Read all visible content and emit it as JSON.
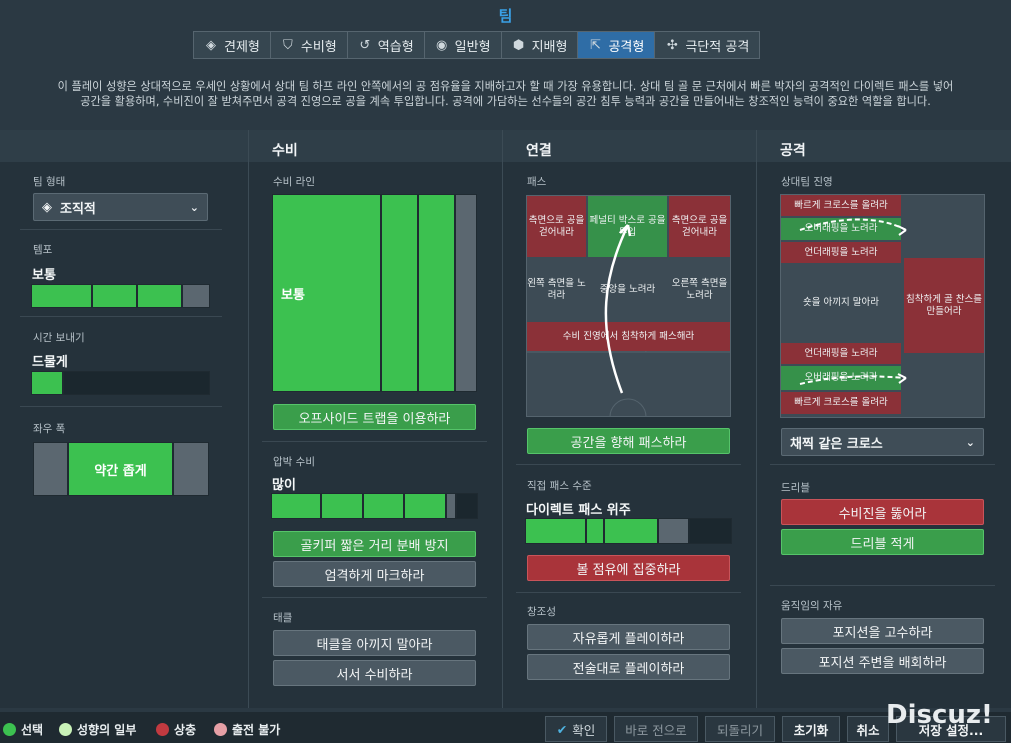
{
  "title": "팀",
  "tabs": [
    {
      "label": "견제형",
      "icon": "shield-split-icon"
    },
    {
      "label": "수비형",
      "icon": "shield-icon"
    },
    {
      "label": "역습형",
      "icon": "counter-icon"
    },
    {
      "label": "일반형",
      "icon": "balanced-icon"
    },
    {
      "label": "지배형",
      "icon": "cube-icon"
    },
    {
      "label": "공격형",
      "icon": "attack-arrow-icon"
    },
    {
      "label": "극단적 공격",
      "icon": "extreme-attack-icon"
    }
  ],
  "description_line1": "이 플레이 성향은 상대적으로 우세인 상황에서 상대 팀 하프 라인 안쪽에서의 공 점유율을 지배하고자 할 때 가장 유용합니다. 상대 팀 골 문 근처에서 빠른 박자의 공격적인 다이렉트 패스를 넣어",
  "description_line2": "공간을 활용하며, 수비진이 잘 받쳐주면서 공격 진영으로 공을 계속 투입합니다. 공격에 가담하는 선수들의 공간 침투 능력과 공간을 만들어내는 창조적인 능력이 중요한 역할을 합니다.",
  "columns": {
    "defense": "수비",
    "link": "연결",
    "attack": "공격"
  },
  "left": {
    "team_shape_label": "팀 형태",
    "team_shape_value": "조직적",
    "tempo_label": "템포",
    "tempo_value": "보통",
    "time_wasting_label": "시간 보내기",
    "time_wasting_value": "드물게",
    "width_label": "좌우 폭",
    "width_value": "약간 좁게"
  },
  "defense": {
    "line_label": "수비 라인",
    "line_value": "보통",
    "offside_button": "오프사이드 트랩을 이용하라",
    "press_label": "압박 수비",
    "press_value": "많이",
    "gk_button": "골키퍼 짧은 거리 분배 방지",
    "mark_button": "엄격하게 마크하라",
    "tackle_label": "태클",
    "tackle_button1": "태클을 아끼지 말아라",
    "tackle_button2": "서서 수비하라"
  },
  "link": {
    "pass_label": "패스",
    "grid": [
      "측면으로 공을 걷어내라",
      "페널티 박스로 공을 투입",
      "측면으로 공을 걷어내라",
      "왼쪽 측면을 노려라",
      "중앙을 노려라",
      "오른쪽 측면을 노려라",
      "수비 진영에서 침착하게 패스해라"
    ],
    "space_button": "공간을 향해 패스하라",
    "directness_label": "직접 패스 수준",
    "directness_value": "다이렉트 패스 위주",
    "possession_button": "볼 점유에 집중하라",
    "creativity_label": "창조성",
    "creative_button1": "자유롭게 플레이하라",
    "creative_button2": "전술대로 플레이하라"
  },
  "attack": {
    "progress_label": "상대팀 진영",
    "grid": [
      "빠르게 크로스를 올려라",
      "오버래핑을 노려라",
      "언더래핑을 노려라",
      "숏을 아끼지 말아라",
      "침착하게 골 찬스를 만들어라",
      "언더래핑을 노려라",
      "오버래핑을 노려라",
      "빠르게 크로스를 올려라"
    ],
    "cross_value": "채찍 같은 크로스",
    "dribble_label": "드리블",
    "dribble_button1": "수비진을 뚫어라",
    "dribble_button2": "드리블 적게",
    "freedom_label": "움직임의 자유",
    "freedom_button1": "포지션을 고수하라",
    "freedom_button2": "포지션 주변을 배회하라"
  },
  "legend": [
    {
      "label": "선택",
      "color": "#3cc150"
    },
    {
      "label": "성향의 일부",
      "color": "#c9f2b8"
    },
    {
      "label": "상충",
      "color": "#c23a40"
    },
    {
      "label": "출전 불가",
      "color": "#e6a0a6"
    }
  ],
  "footer": {
    "confirm": "확인",
    "back": "바로 전으로",
    "undo": "되돌리기",
    "reset": "초기화",
    "cancel": "취소",
    "save": "저장 설정..."
  },
  "watermark": "Discuz!"
}
